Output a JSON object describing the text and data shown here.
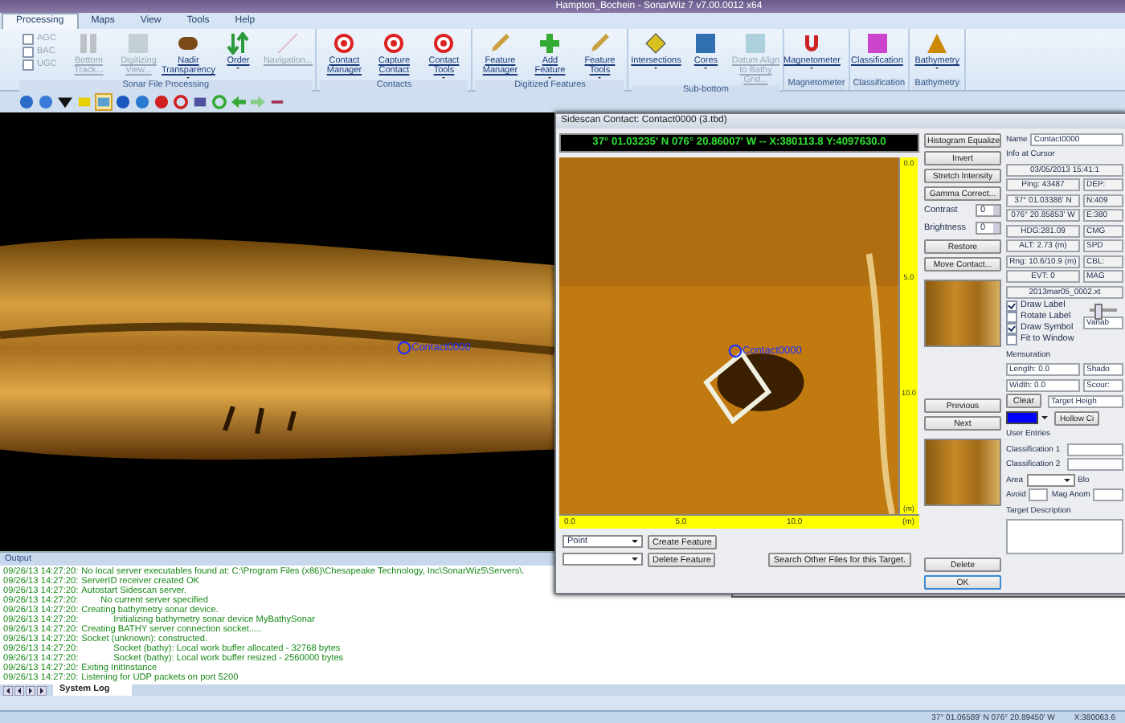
{
  "window": {
    "title": "Hampton_Bochein - SonarWiz 7 v7.00.0012 x64"
  },
  "tabs": [
    {
      "label": "Processing",
      "selected": true
    },
    {
      "label": "Maps",
      "selected": false
    },
    {
      "label": "View",
      "selected": false
    },
    {
      "label": "Tools",
      "selected": false
    },
    {
      "label": "Help",
      "selected": false
    }
  ],
  "ribbon": {
    "groups": [
      {
        "label": "Sonar File Processing",
        "checkboxes": [
          {
            "label": "AGC",
            "checked": false,
            "disabled": true
          },
          {
            "label": "BAC",
            "checked": false,
            "disabled": true
          },
          {
            "label": "UGC",
            "checked": false,
            "disabled": true
          }
        ],
        "buttons": [
          {
            "label": "Bottom Track...",
            "kind": "track",
            "disabled": true,
            "dropdown": false
          },
          {
            "label": "Digitizing View...",
            "kind": "view",
            "disabled": true,
            "dropdown": false
          },
          {
            "label": "Nadir Transparency",
            "kind": "nadir",
            "disabled": false,
            "dropdown": true
          },
          {
            "label": "Order",
            "kind": "order",
            "disabled": false,
            "dropdown": true
          },
          {
            "label": "Navigation...",
            "kind": "navigation",
            "disabled": true,
            "dropdown": false
          }
        ]
      },
      {
        "label": "Contacts",
        "buttons": [
          {
            "label": "Contact Manager",
            "kind": "contact",
            "disabled": false,
            "dropdown": false
          },
          {
            "label": "Capture Contact",
            "kind": "capture",
            "disabled": false,
            "dropdown": false
          },
          {
            "label": "Contact Tools",
            "kind": "tools",
            "disabled": false,
            "dropdown": true
          }
        ]
      },
      {
        "label": "Digitized Features",
        "buttons": [
          {
            "label": "Feature Manager",
            "kind": "feature",
            "disabled": false,
            "dropdown": false
          },
          {
            "label": "Add Feature",
            "kind": "add",
            "disabled": false,
            "dropdown": true
          },
          {
            "label": "Feature Tools",
            "kind": "feature",
            "disabled": false,
            "dropdown": true
          }
        ]
      },
      {
        "label": "Sub-bottom",
        "buttons": [
          {
            "label": "Intersections",
            "kind": "intersections",
            "disabled": false,
            "dropdown": true
          },
          {
            "label": "Cores",
            "kind": "cores",
            "disabled": false,
            "dropdown": true
          },
          {
            "label": "Datum Align to Bathy Grid...",
            "kind": "datum",
            "disabled": true,
            "dropdown": false
          }
        ]
      },
      {
        "label": "Magnetometer",
        "buttons": [
          {
            "label": "Magnetometer",
            "kind": "magnet",
            "disabled": false,
            "dropdown": true
          }
        ]
      },
      {
        "label": "Classification",
        "buttons": [
          {
            "label": "Classification",
            "kind": "classification",
            "disabled": false,
            "dropdown": false
          }
        ]
      },
      {
        "label": "Bathymetry",
        "buttons": [
          {
            "label": "Bathymetry",
            "kind": "bathymetry",
            "disabled": false,
            "dropdown": true
          }
        ]
      }
    ]
  },
  "map": {
    "contact_label": "Contact0000"
  },
  "dialog": {
    "title": "Sidescan Contact: Contact0000 (3.tbd)",
    "coordinates": "37° 01.03235' N 076° 20.86007' W -- X:380113.8 Y:4097630.0",
    "contact_label": "Contact0000",
    "h_scale": [
      "0.0",
      "5.0",
      "10.0",
      "(m)"
    ],
    "v_scale": [
      "0.0",
      "5.0",
      "10.0",
      "(m)"
    ],
    "buttons_top": [
      "Histogram Equalize",
      "Invert",
      "Stretch Intensity",
      "Gamma Correct..."
    ],
    "spinners": [
      {
        "label": "Contrast",
        "value": "0"
      },
      {
        "label": "Brightness",
        "value": "0"
      }
    ],
    "buttons_mid": [
      "Restore",
      "Move Contact..."
    ],
    "nav_buttons": [
      "Previous",
      "Next"
    ],
    "delete_button": "Delete",
    "ok_button": "OK",
    "feature_type": "Point",
    "feature_buttons": [
      "Create Feature",
      "Delete Feature"
    ],
    "search_button": "Search Other Files for this Target.",
    "info": {
      "name_label": "Name",
      "name_value": "Contact0000",
      "heading": "Info at Cursor",
      "date": "03/05/2013 15:41:1",
      "pairs": [
        [
          "Ping: 43487",
          "DEP:"
        ],
        [
          "37° 01.03386' N",
          "N:409"
        ],
        [
          "076° 20.85853' W",
          "E:380"
        ],
        [
          "HDG:281.09",
          "CMG"
        ],
        [
          "ALT: 2.73 (m)",
          "SPD"
        ],
        [
          "Rng: 10.6/10.9 (m)",
          "CBL:"
        ],
        [
          "EVT: 0",
          "MAG"
        ]
      ],
      "file": "2013mar05_0002.xt",
      "checkboxes": [
        {
          "label": "Draw Label",
          "checked": true
        },
        {
          "label": "Rotate Label",
          "checked": false
        },
        {
          "label": "Draw Symbol",
          "checked": true
        },
        {
          "label": "Fit to Window",
          "checked": false
        }
      ],
      "slider": {
        "level": 0.3
      },
      "variable": "Variab",
      "mensuration": "Mensuration",
      "length": "Length: 0.0",
      "width": "Width: 0.0",
      "shadow": "Shado",
      "scour": "Scour:",
      "clear": "Clear",
      "target_height": "Target Heigh",
      "hollow": "Hollow Ci",
      "user_entries": "User Entries",
      "class1": "Classification 1",
      "class2": "Classification 2",
      "area": "Area",
      "block": "Blo",
      "avoid": "Avoid",
      "mag_anom": "Mag Anom",
      "target_description": "Target Description"
    }
  },
  "output": {
    "title": "Output",
    "lines": [
      {
        "time": "09/26/13 14:27:20:",
        "message": "No local server executables found at: C:\\Program Files (x86)\\Chesapeake Technology, Inc\\SonarWiz5\\Servers\\.",
        "kind": "plain"
      },
      {
        "time": "09/26/13 14:27:20:",
        "message": "ServerID receiver created OK",
        "kind": "plain"
      },
      {
        "time": "09/26/13 14:27:20:",
        "message": "Autostart Sidescan server.",
        "kind": "plain"
      },
      {
        "time": "09/26/13 14:27:20:",
        "message": "No current server specified",
        "kind": "indent"
      },
      {
        "time": "09/26/13 14:27:20:",
        "message": "Creating bathymetry sonar device.",
        "kind": "plain"
      },
      {
        "time": "09/26/13 14:27:20:",
        "message": "Initializing bathymetry sonar device MyBathySonar",
        "kind": "indent2"
      },
      {
        "time": "09/26/13 14:27:20:",
        "message": "Creating BATHY server connection socket.....",
        "kind": "plain"
      },
      {
        "time": "09/26/13 14:27:20:",
        "message": "Socket (unknown): constructed.",
        "kind": "plain"
      },
      {
        "time": "09/26/13 14:27:20:",
        "message": "Socket (bathy): Local work buffer allocated - 32768 bytes",
        "kind": "indent2"
      },
      {
        "time": "09/26/13 14:27:20:",
        "message": "Socket (bathy): Local work buffer resized - 2560000 bytes",
        "kind": "indent2"
      },
      {
        "time": "09/26/13 14:27:20:",
        "message": "Exiting InitInstance",
        "kind": "plain"
      },
      {
        "time": "09/26/13 14:27:20:",
        "message": "Listening for UDP packets on port 5200",
        "kind": "plain"
      }
    ],
    "tabs": [
      {
        "label": "System Log",
        "selected": true
      }
    ]
  },
  "status_bar": {
    "position": "37° 01.06589' N 076° 20.89450' W",
    "xy": "X:380063.6"
  }
}
